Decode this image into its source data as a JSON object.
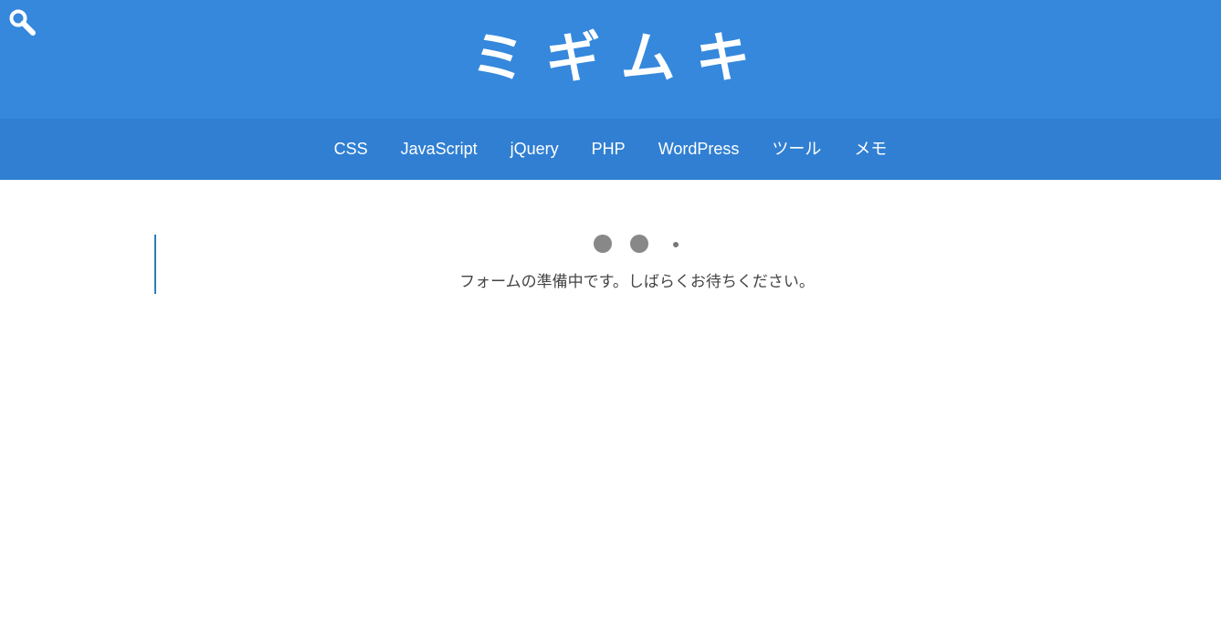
{
  "header": {
    "site_title": "ミギムキ",
    "search_icon": "search-icon",
    "background_color": "#3588dc"
  },
  "nav": {
    "background_color": "#307fd2",
    "items": [
      {
        "label": "CSS"
      },
      {
        "label": "JavaScript"
      },
      {
        "label": "jQuery"
      },
      {
        "label": "PHP"
      },
      {
        "label": "WordPress"
      },
      {
        "label": "ツール"
      },
      {
        "label": "メモ"
      }
    ]
  },
  "main": {
    "loading_indicator": "loading-dots",
    "loading_text": "フォームの準備中です。しばらくお待ちください。"
  }
}
